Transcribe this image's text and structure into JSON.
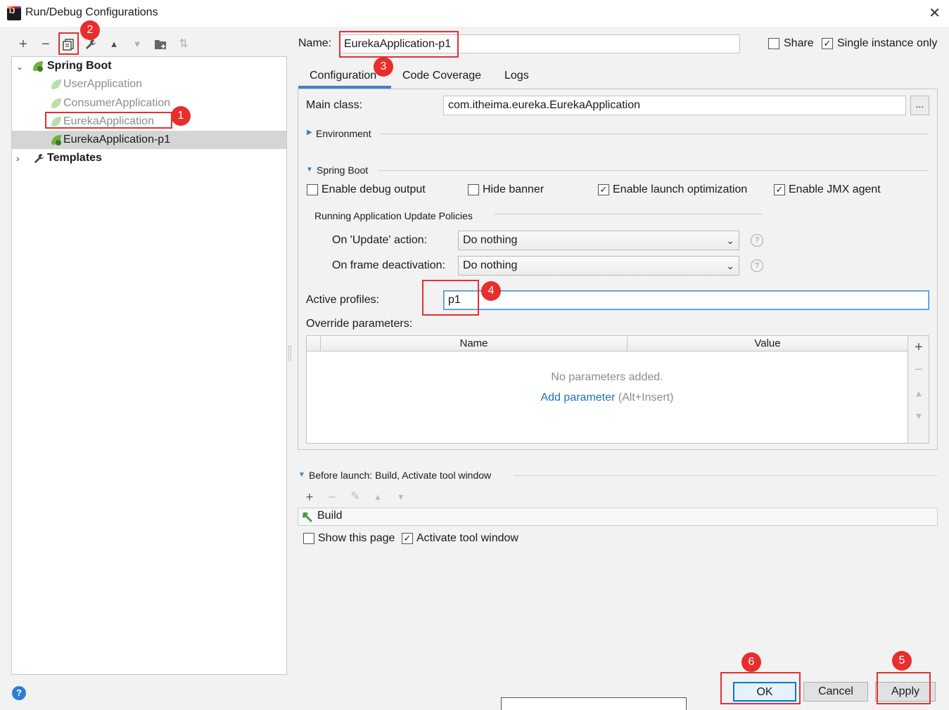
{
  "window": {
    "title": "Run/Debug Configurations",
    "close_glyph": "✕"
  },
  "toolbar": {
    "add_glyph": "+",
    "remove_glyph": "−",
    "copy_glyph": "⧉",
    "wrench_glyph": "🔧",
    "up_glyph": "▲",
    "down_glyph": "▼",
    "folder_glyph": "📁",
    "sort_glyph": "⇅"
  },
  "tree": {
    "group_label": "Spring Boot",
    "items": [
      {
        "label": "UserApplication"
      },
      {
        "label": "ConsumerApplication"
      },
      {
        "label": "EurekaApplication"
      },
      {
        "label": "EurekaApplication-p1"
      }
    ],
    "templates_label": "Templates"
  },
  "badges": {
    "b1": "1",
    "b2": "2",
    "b3": "3",
    "b4": "4",
    "b5": "5",
    "b6": "6"
  },
  "header": {
    "name_label": "Name:",
    "name_value": "EurekaApplication-p1",
    "share_label": "Share",
    "share_checked": false,
    "single_instance_label": "Single instance only",
    "single_instance_checked": true
  },
  "tabs": [
    {
      "label": "Configuration",
      "active": true
    },
    {
      "label": "Code Coverage",
      "active": false
    },
    {
      "label": "Logs",
      "active": false
    }
  ],
  "config": {
    "main_class_label": "Main class:",
    "main_class_value": "com.itheima.eureka.EurekaApplication",
    "browse_glyph": "...",
    "environment_label": "Environment",
    "spring_boot_label": "Spring Boot",
    "options": [
      {
        "label": "Enable debug output",
        "checked": false
      },
      {
        "label": "Hide banner",
        "checked": false
      },
      {
        "label": "Enable launch optimization",
        "checked": true
      },
      {
        "label": "Enable JMX agent",
        "checked": true
      }
    ],
    "policies_label": "Running Application Update Policies",
    "update_action_label": "On 'Update' action:",
    "update_action_value": "Do nothing",
    "frame_deactivation_label": "On frame deactivation:",
    "frame_deactivation_value": "Do nothing",
    "active_profiles_label": "Active profiles:",
    "active_profiles_value": "p1",
    "override_label": "Override parameters:",
    "table": {
      "columns": [
        "Name",
        "Value"
      ],
      "empty_text": "No parameters added.",
      "add_link": "Add parameter",
      "add_shortcut": "(Alt+Insert)"
    }
  },
  "before_launch": {
    "label": "Before launch: Build, Activate tool window",
    "items": [
      {
        "label": "Build"
      }
    ],
    "show_page_label": "Show this page",
    "show_page_checked": false,
    "activate_label": "Activate tool window",
    "activate_checked": true
  },
  "buttons": {
    "ok": "OK",
    "cancel": "Cancel",
    "apply": "Apply",
    "help_glyph": "?"
  },
  "colors": {
    "accent": "#0078d7",
    "annotation_red": "#e53030",
    "spring_green": "#6db33f",
    "link": "#2470b3"
  }
}
